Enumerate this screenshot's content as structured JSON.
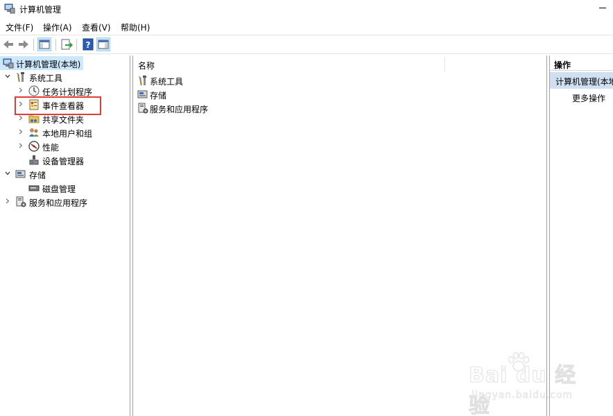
{
  "window": {
    "title": "计算机管理"
  },
  "menubar": {
    "items": [
      "文件(F)",
      "操作(A)",
      "查看(V)",
      "帮助(H)"
    ]
  },
  "tree": {
    "root": "计算机管理(本地)",
    "items": [
      {
        "label": "系统工具",
        "icon": "tools-icon"
      },
      {
        "label": "任务计划程序",
        "icon": "clock-icon"
      },
      {
        "label": "事件查看器",
        "icon": "event-viewer-icon"
      },
      {
        "label": "共享文件夹",
        "icon": "shared-folder-icon"
      },
      {
        "label": "本地用户和组",
        "icon": "users-icon"
      },
      {
        "label": "性能",
        "icon": "performance-icon"
      },
      {
        "label": "设备管理器",
        "icon": "device-manager-icon"
      },
      {
        "label": "存储",
        "icon": "storage-icon"
      },
      {
        "label": "磁盘管理",
        "icon": "disk-icon"
      },
      {
        "label": "服务和应用程序",
        "icon": "services-icon"
      }
    ]
  },
  "list": {
    "column_name": "名称",
    "rows": [
      "系统工具",
      "存储",
      "服务和应用程序"
    ]
  },
  "actions": {
    "header": "操作",
    "selected": "计算机管理(本地)",
    "more": "更多操作"
  },
  "watermark": {
    "brand": "Bai du 经验",
    "url": "jingyan.baidu.com"
  },
  "colors": {
    "selection": "#cce8ff",
    "highlight_border": "#e53935",
    "actions_selected": "#cfe0f0"
  }
}
